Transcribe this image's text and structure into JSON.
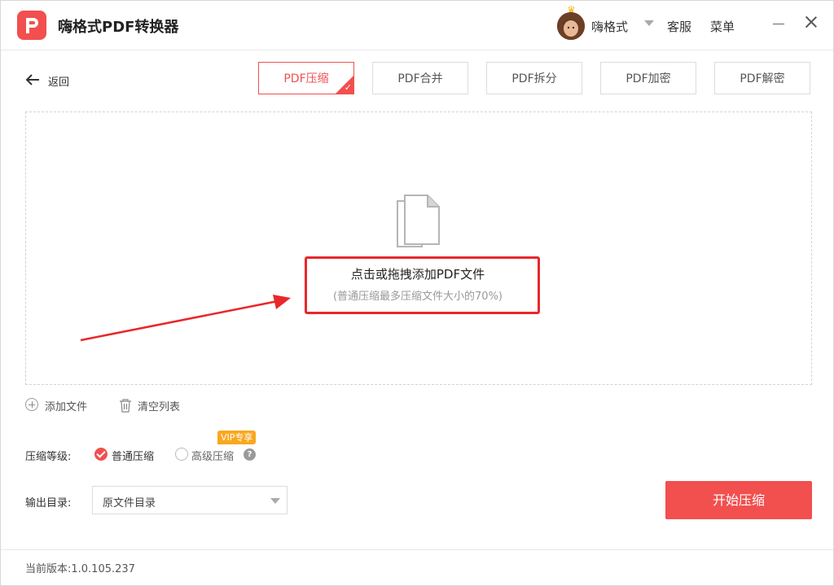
{
  "app": {
    "title": "嗨格式PDF转换器",
    "username": "嗨格式",
    "service": "客服",
    "menu": "菜单"
  },
  "nav": {
    "back": "返回"
  },
  "tabs": [
    {
      "label": "PDF压缩",
      "active": true
    },
    {
      "label": "PDF合并"
    },
    {
      "label": "PDF拆分"
    },
    {
      "label": "PDF加密"
    },
    {
      "label": "PDF解密"
    }
  ],
  "dropzone": {
    "main": "点击或拖拽添加PDF文件",
    "sub": "(普通压缩最多压缩文件大小的70%)"
  },
  "actions": {
    "add_file": "添加文件",
    "clear_list": "清空列表"
  },
  "compression": {
    "label": "压缩等级:",
    "normal": "普通压缩",
    "advanced": "高级压缩",
    "vip_badge": "VIP专享",
    "selected": "普通压缩",
    "help": "?"
  },
  "output": {
    "label": "输出目录:",
    "value": "原文件目录"
  },
  "start_button": "开始压缩",
  "footer": {
    "version": "当前版本:1.0.105.237"
  },
  "colors": {
    "accent": "#f24f4f",
    "highlight": "#e8282b",
    "vip": "#f9a71f"
  }
}
